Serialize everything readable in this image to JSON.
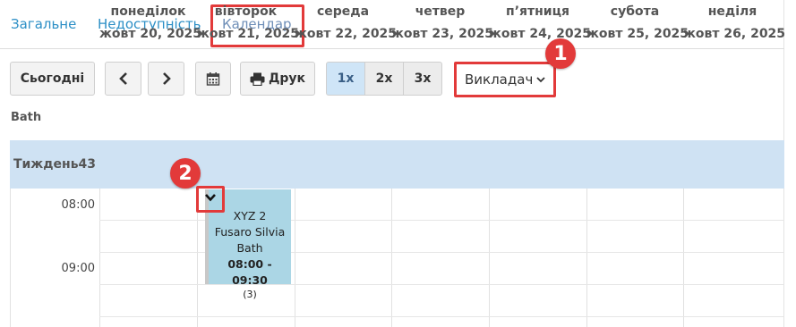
{
  "tabs": [
    {
      "label": "Загальне"
    },
    {
      "label": "Недоступність"
    },
    {
      "label": "Календар"
    }
  ],
  "toolbar": {
    "today_label": "Сьогодні",
    "prev_icon": "chevron-left-icon",
    "next_icon": "chevron-right-icon",
    "calendar_icon": "calendar-icon",
    "print_label": "Друк",
    "zoom_options": [
      "1x",
      "2x",
      "3x"
    ],
    "zoom_selected": "1x",
    "view_selected": "Викладач"
  },
  "annotations": [
    "1",
    "2"
  ],
  "resource_name": "Bath",
  "calendar": {
    "week_label": "Тиждень43",
    "days": [
      {
        "name": "понеділок",
        "date": "жовт 20, 2025"
      },
      {
        "name": "вівторок",
        "date": "жовт 21, 2025"
      },
      {
        "name": "середа",
        "date": "жовт 22, 2025"
      },
      {
        "name": "четвер",
        "date": "жовт 23, 2025"
      },
      {
        "name": "п’ятниця",
        "date": "жовт 24, 2025"
      },
      {
        "name": "субота",
        "date": "жовт 25, 2025"
      },
      {
        "name": "неділя",
        "date": "жовт 26, 2025"
      }
    ],
    "times": [
      "08:00",
      "09:00"
    ],
    "event": {
      "title": "XYZ 2",
      "teacher": "Fusaro Silvia",
      "room": "Bath",
      "time": "08:00 - 09:30",
      "count": "(3)",
      "color": "#abd6e5"
    }
  },
  "colors": {
    "highlight": "#e23a3a",
    "header_bg": "#cfe2f3",
    "tab_link": "#2d8fc6"
  }
}
